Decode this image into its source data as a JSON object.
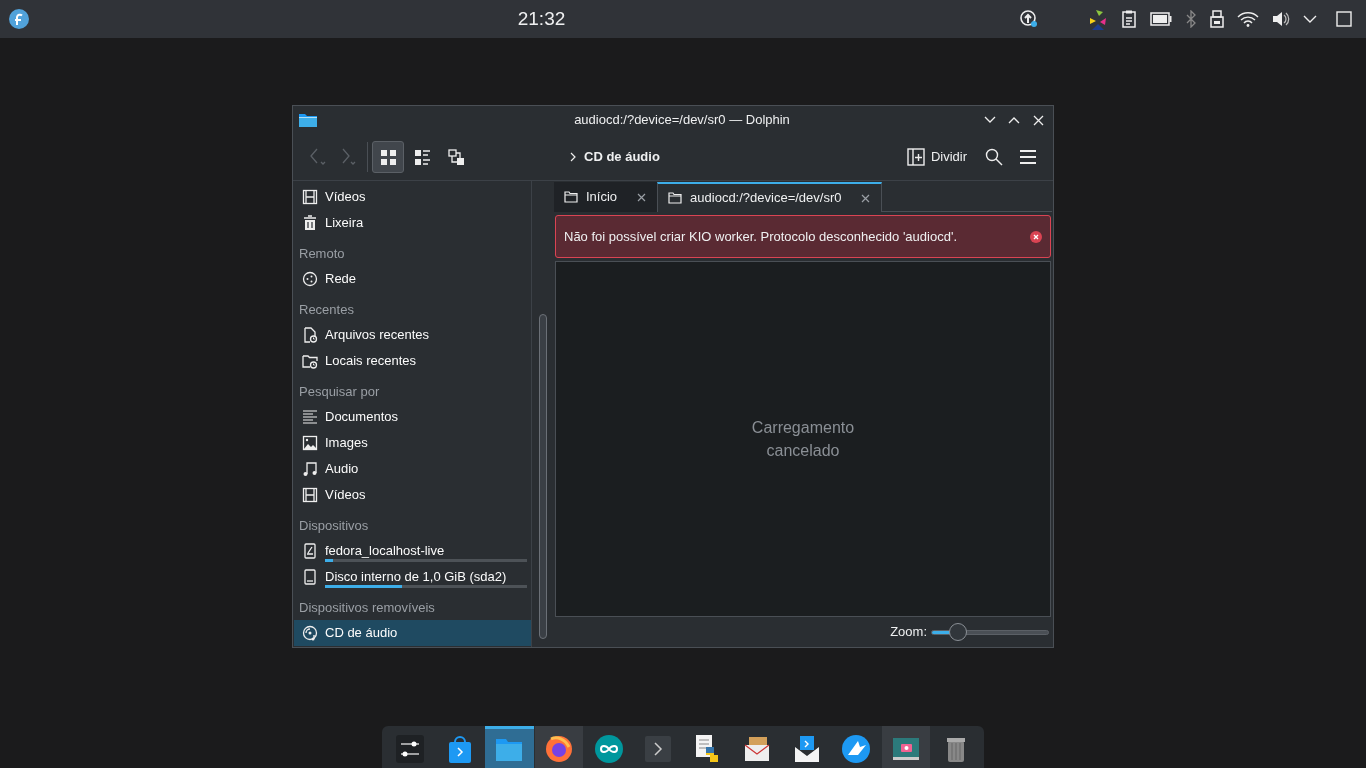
{
  "top_panel": {
    "clock": "21:32"
  },
  "window": {
    "title": "audiocd:/?device=/dev/sr0 — Dolphin"
  },
  "toolbar": {
    "view_modes": [
      {
        "selected": true
      },
      {
        "selected": false
      },
      {
        "selected": false
      }
    ],
    "breadcrumb": "CD de áudio",
    "split_button": "Dividir"
  },
  "sidebar": {
    "items": [
      {
        "kind": "place",
        "label": "Vídeos",
        "selected": false
      },
      {
        "kind": "place",
        "label": "Lixeira",
        "selected": false
      },
      {
        "kind": "section",
        "label": "Remoto"
      },
      {
        "kind": "place",
        "label": "Rede",
        "selected": false
      },
      {
        "kind": "section",
        "label": "Recentes"
      },
      {
        "kind": "place",
        "label": "Arquivos recentes",
        "selected": false
      },
      {
        "kind": "place",
        "label": "Locais recentes",
        "selected": false
      },
      {
        "kind": "section",
        "label": "Pesquisar por"
      },
      {
        "kind": "place",
        "label": "Documentos",
        "selected": false
      },
      {
        "kind": "place",
        "label": "Images",
        "selected": false
      },
      {
        "kind": "place",
        "label": "Audio",
        "selected": false
      },
      {
        "kind": "place",
        "label": "Vídeos",
        "selected": false
      },
      {
        "kind": "section",
        "label": "Dispositivos"
      },
      {
        "kind": "device",
        "label": "fedora_localhost-live",
        "selected": false,
        "level": 0.04
      },
      {
        "kind": "device",
        "label": "Disco interno de 1,0 GiB (sda2)",
        "selected": false,
        "level": 0.38
      },
      {
        "kind": "section",
        "label": "Dispositivos removíveis"
      },
      {
        "kind": "place",
        "label": "CD de áudio",
        "selected": true
      }
    ]
  },
  "tabs": [
    {
      "label": "Início",
      "selected": false
    },
    {
      "label": "audiocd:/?device=/dev/sr0",
      "selected": true
    }
  ],
  "error_message": "Não foi possível criar KIO worker. Protocolo desconhecido 'audiocd'.",
  "view": {
    "message": "Carregamento cancelado"
  },
  "status_bar": {
    "zoom_label": "Zoom:",
    "zoom": {
      "level": 0.18
    }
  },
  "dock": [
    {
      "selected": false,
      "running": false
    },
    {
      "selected": false,
      "running": false
    },
    {
      "selected": true,
      "running": true
    },
    {
      "selected": false,
      "running": true
    },
    {
      "selected": false,
      "running": false
    },
    {
      "selected": false,
      "running": false
    },
    {
      "selected": false,
      "running": false
    },
    {
      "selected": false,
      "running": false
    },
    {
      "selected": false,
      "running": false
    },
    {
      "selected": false,
      "running": false
    },
    {
      "selected": false,
      "running": true
    },
    {
      "selected": false,
      "running": false
    }
  ]
}
